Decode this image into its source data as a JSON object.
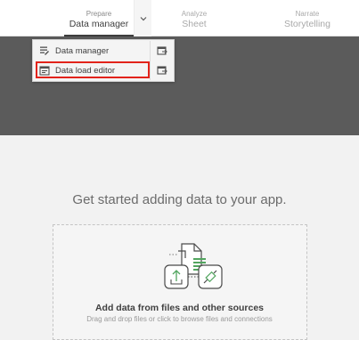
{
  "tabs": [
    {
      "small": "Prepare",
      "big": "Data manager"
    },
    {
      "small": "Analyze",
      "big": "Sheet"
    },
    {
      "small": "Narrate",
      "big": "Storytelling"
    }
  ],
  "menu": {
    "items": [
      {
        "label": "Data manager",
        "icon": "data-manager-icon",
        "action_icon": "open-new-tab-icon"
      },
      {
        "label": "Data load editor",
        "icon": "script-editor-icon",
        "action_icon": "open-new-tab-icon"
      }
    ]
  },
  "main": {
    "headline": "Get started adding data to your app.",
    "drop_title": "Add data from files and other sources",
    "drop_subtitle": "Drag and drop files or click to browse files and connections"
  },
  "colors": {
    "highlight": "#e2231a",
    "accent": "#52a55f"
  }
}
